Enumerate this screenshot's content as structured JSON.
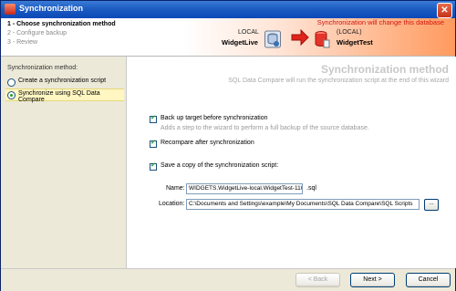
{
  "window": {
    "title": "Synchronization"
  },
  "header": {
    "steps": [
      "1 - Choose synchronization method",
      "2 - Configure backup",
      "3 - Review"
    ],
    "warning": "Synchronization will change this database",
    "source_label": "LOCAL",
    "source_name": "WidgetLive",
    "target_label": "(LOCAL)",
    "target_name": "WidgetTest"
  },
  "sidebar": {
    "label": "Synchronization method:",
    "options": [
      {
        "label": "Create a synchronization script",
        "selected": false
      },
      {
        "label": "Synchronize using SQL Data Compare",
        "selected": true
      }
    ]
  },
  "main": {
    "heading": "Synchronization method",
    "subheading": "SQL Data Compare will run the synchronization script at the end of this wizard",
    "backup": {
      "label": "Back up target before synchronization",
      "checked": true,
      "note": "Adds a step to the wizard to perform a full backup of the source database."
    },
    "recompare": {
      "label": "Recompare after synchronization",
      "checked": true
    },
    "savecopy": {
      "label": "Save a copy of the synchronization script:",
      "checked": true
    },
    "name_label": "Name:",
    "name_value": "WIDGETS.WidgetLive-local.WidgetTest-1105",
    "name_suffix": ".sql",
    "location_label": "Location:",
    "location_value": "C:\\Documents and Settings\\example\\My Documents\\SQL Data Compare\\SQL Scripts",
    "browse_label": "..."
  },
  "footer": {
    "back": "< Back",
    "next": "Next >",
    "cancel": "Cancel"
  },
  "colors": {
    "warning": "#d0150f",
    "titlebar": "#1d5cc2",
    "selected_option": "#fff6c2"
  }
}
